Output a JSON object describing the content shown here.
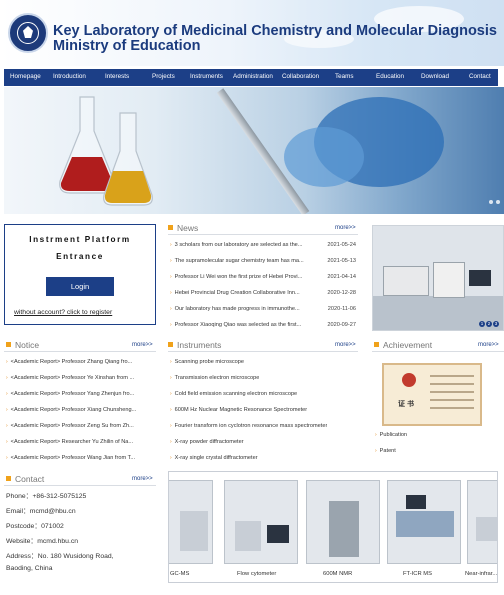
{
  "header": {
    "title_line1": "Key Laboratory of Medicinal Chemistry and Molecular Diagnosis",
    "title_line2": "Ministry of Education"
  },
  "nav": [
    "Homepage",
    "Introduction",
    "Interests",
    "Projects",
    "Instruments",
    "Administration",
    "Collaboration",
    "Teams",
    "Education",
    "Download",
    "Contact"
  ],
  "login": {
    "line1": "Instrment Platform",
    "line2": "Entrance",
    "button": "Login",
    "register": "without account? click to register"
  },
  "news": {
    "title": "News",
    "more": "more>>",
    "items": [
      {
        "text": "3 scholars from our laboratory are selected as the...",
        "date": "2021-05-24"
      },
      {
        "text": "The supramolecular sugar chemistry team has ma...",
        "date": "2021-05-13"
      },
      {
        "text": "Professor Li Wei won the first prize of Hebei Provi...",
        "date": "2021-04-14"
      },
      {
        "text": "Hebei Provincial Drug Creation Collaborative Inn...",
        "date": "2020-12-28"
      },
      {
        "text": "Our laboratory has made progress in immunothe...",
        "date": "2020-11-06"
      },
      {
        "text": "Professor Xiaoqing Qiao was selected as the first...",
        "date": "2020-09-27"
      }
    ]
  },
  "notice": {
    "title": "Notice",
    "more": "more>>",
    "items": [
      "<Academic Report> Professor Zhang Qiang fro...",
      "<Academic Report> Professor Ye Xinshan from ...",
      "<Academic Report> Professor Yang Zhenjun fro...",
      "<Academic Report> Professor Xiang Chunsheng...",
      "<Academic Report> Professor Zeng Su from Zh...",
      "<Academic Report> Researcher Yu Zhilin of Na...",
      "<Academic Report> Professor Wang Jian from T..."
    ]
  },
  "instruments": {
    "title": "Instruments",
    "more": "more>>",
    "items": [
      "Scanning probe microscope",
      "Transmission electron microscope",
      "Cold field emission scanning electron microscope",
      "600M Hz Nuclear Magnetic Resonance Spectrometer",
      "Fourier transform ion cyclotron resonance mass spectrometer",
      "X-ray powder diffractometer",
      "X-ray single crystal diffractometer"
    ]
  },
  "achievement": {
    "title": "Achievement",
    "more": "more>>",
    "cert_word": "证  书",
    "items": [
      "Publication",
      "Patent"
    ]
  },
  "slider_pages": [
    "1",
    "2",
    "3"
  ],
  "contact": {
    "title": "Contact",
    "more": "more>>",
    "phone": "Phone：+86-312-5075125",
    "email": "Email：mcmd@hbu.cn",
    "postcode": "Postcode：071002",
    "website": "Website：mcmd.hbu.cn",
    "address1": "Address：No. 180 Wusidong Road,",
    "address2": "Baoding, China"
  },
  "gallery": [
    "GC-MS",
    "Flow cytometer",
    "600M NMR",
    "FT-ICR MS",
    "Near-infrar..."
  ]
}
